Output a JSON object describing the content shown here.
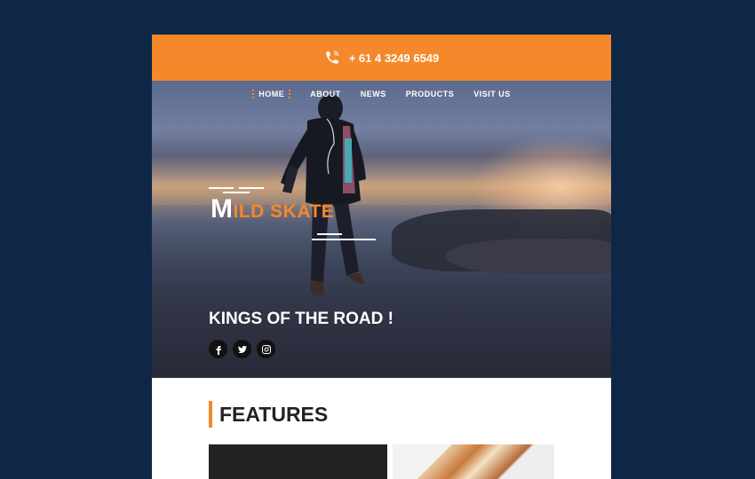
{
  "header": {
    "phone": "+ 61 4 3249 6549",
    "phone_icon": "phone-icon"
  },
  "nav": {
    "items": [
      {
        "label": "HOME",
        "active": true
      },
      {
        "label": "ABOUT"
      },
      {
        "label": "NEWS"
      },
      {
        "label": "PRODUCTS"
      },
      {
        "label": "VISIT US"
      }
    ]
  },
  "hero": {
    "brand_first_letter": "M",
    "brand_rest": "ILD SKATE",
    "tagline": "KINGS OF THE ROAD !",
    "social": [
      "facebook-icon",
      "twitter-icon",
      "instagram-icon"
    ]
  },
  "features": {
    "title": "FEATURES"
  },
  "colors": {
    "background": "#0f2746",
    "accent": "#f5882a",
    "white": "#ffffff",
    "dark": "#222222"
  }
}
